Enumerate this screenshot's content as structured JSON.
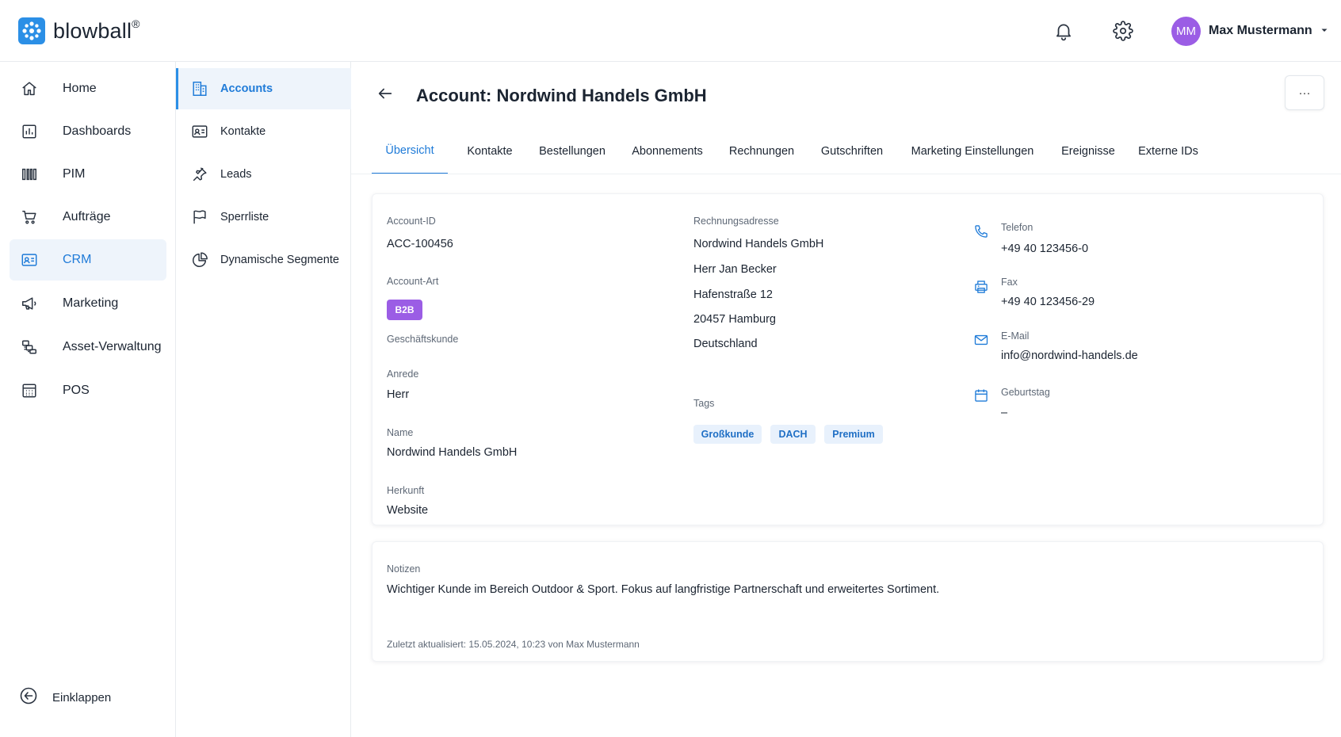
{
  "header": {
    "brand": "blowball",
    "brand_mark": "®",
    "user_initials": "MM",
    "user_name": "Max Mustermann",
    "icons": [
      "bell-icon",
      "gear-icon",
      "chevron-down-icon"
    ]
  },
  "sidebar": {
    "items": [
      {
        "label": "Home",
        "icon": "home-icon"
      },
      {
        "label": "Dashboards",
        "icon": "dashboard-icon"
      },
      {
        "label": "PIM",
        "icon": "barcode-icon"
      },
      {
        "label": "Aufträge",
        "icon": "cart-icon"
      },
      {
        "label": "CRM",
        "icon": "contact-card-icon"
      },
      {
        "label": "Marketing",
        "icon": "megaphone-icon"
      },
      {
        "label": "Asset-Verwaltung",
        "icon": "assets-icon"
      },
      {
        "label": "POS",
        "icon": "calculator-icon"
      }
    ],
    "collapse_label": "Einklappen"
  },
  "subnav": {
    "items": [
      {
        "label": "Accounts",
        "icon": "building-icon"
      },
      {
        "label": "Kontakte",
        "icon": "contact-card-icon"
      },
      {
        "label": "Leads",
        "icon": "pin-icon"
      },
      {
        "label": "Sperrliste",
        "icon": "flag-icon"
      },
      {
        "label": "Dynamische Segmente",
        "icon": "pie-chart-icon"
      }
    ]
  },
  "page": {
    "title": "Account: Nordwind Handels GmbH",
    "more_label": "···"
  },
  "tabs": [
    "Übersicht",
    "Kontakte",
    "Bestellungen",
    "Abonnements",
    "Rechnungen",
    "Gutschriften",
    "Marketing Einstellungen",
    "Ereignisse",
    "Externe IDs"
  ],
  "details": {
    "account_id_label": "Account-ID",
    "account_id": "ACC-100456",
    "account_type_label": "Account-Art",
    "account_type_badge": "B2B",
    "account_type_text": "Geschäftskunde",
    "salutation_label": "Anrede",
    "salutation": "Herr",
    "name_label": "Name",
    "name": "Nordwind Handels GmbH",
    "origin_label": "Herkunft",
    "origin": "Website",
    "billing_label": "Rechnungsadresse",
    "billing_lines": [
      "Nordwind Handels GmbH",
      "Herr Jan Becker",
      "Hafenstraße 12",
      "20457 Hamburg",
      "Deutschland"
    ],
    "tags_label": "Tags",
    "tags": [
      "Großkunde",
      "DACH",
      "Premium"
    ],
    "phone_label": "Telefon",
    "phone": "+49 40 123456-0",
    "fax_label": "Fax",
    "fax": "+49 40 123456-29",
    "email_label": "E-Mail",
    "email": "info@nordwind-handels.de",
    "birthday_label": "Geburtstag",
    "birthday": "–"
  },
  "notes": {
    "label": "Notizen",
    "text": "Wichtiger Kunde im Bereich Outdoor & Sport. Fokus auf langfristige Partnerschaft und erweitertes Sortiment.",
    "meta": "Zuletzt aktualisiert: 15.05.2024, 10:23 von Max Mustermann"
  },
  "colors": {
    "accent": "#1f7bd8",
    "brand": "#2b8fe6",
    "avatar": "#9b5de5",
    "badge_b2b": "#9b5de5",
    "tag_bg": "#e8f1fc"
  }
}
